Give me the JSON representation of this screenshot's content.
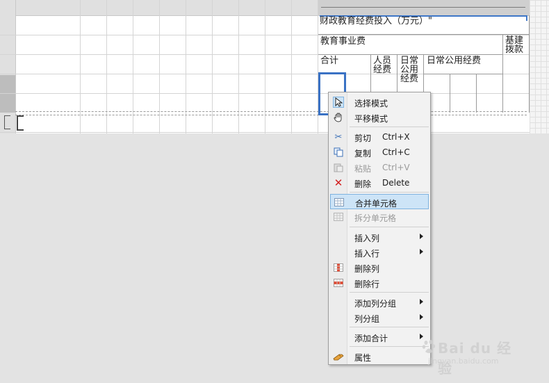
{
  "report": {
    "title": "财政教育经费投入（万元）\"",
    "h_edu": "教育事业费",
    "h_capital": "基建拨款",
    "h_total": "合计",
    "h_staff": "人员经费",
    "h_daily": "日常公用经费",
    "h_daily_wide": "日常公用经费"
  },
  "menu": {
    "items": [
      {
        "label": "选择模式",
        "icon": "pointer-icon"
      },
      {
        "label": "平移模式",
        "icon": "hand-icon"
      },
      {
        "label": "剪切",
        "shortcut": "Ctrl+X",
        "icon": "scissors-icon"
      },
      {
        "label": "复制",
        "shortcut": "Ctrl+C",
        "icon": "copy-icon"
      },
      {
        "label": "粘贴",
        "shortcut": "Ctrl+V",
        "icon": "paste-icon",
        "disabled": true
      },
      {
        "label": "删除",
        "shortcut": "Delete",
        "icon": "delete-icon"
      },
      {
        "label": "合并单元格",
        "icon": "merge-cells-icon",
        "highlighted": true
      },
      {
        "label": "拆分单元格",
        "icon": "split-cells-icon",
        "disabled": true
      },
      {
        "label": "插入列",
        "submenu": true
      },
      {
        "label": "插入行",
        "submenu": true
      },
      {
        "label": "删除列",
        "icon": "delete-column-icon"
      },
      {
        "label": "删除行",
        "icon": "delete-row-icon"
      },
      {
        "label": "添加列分组",
        "submenu": true
      },
      {
        "label": "列分组",
        "submenu": true
      },
      {
        "label": "添加合计",
        "submenu": true
      },
      {
        "label": "属性",
        "icon": "properties-icon"
      }
    ]
  },
  "watermark": {
    "brand": "Bai du 经验",
    "url": "jingyan.baidu.com"
  },
  "colors": {
    "selection": "#3a72c4",
    "highlight": "#cde4f7",
    "delete": "#d21f1f"
  }
}
